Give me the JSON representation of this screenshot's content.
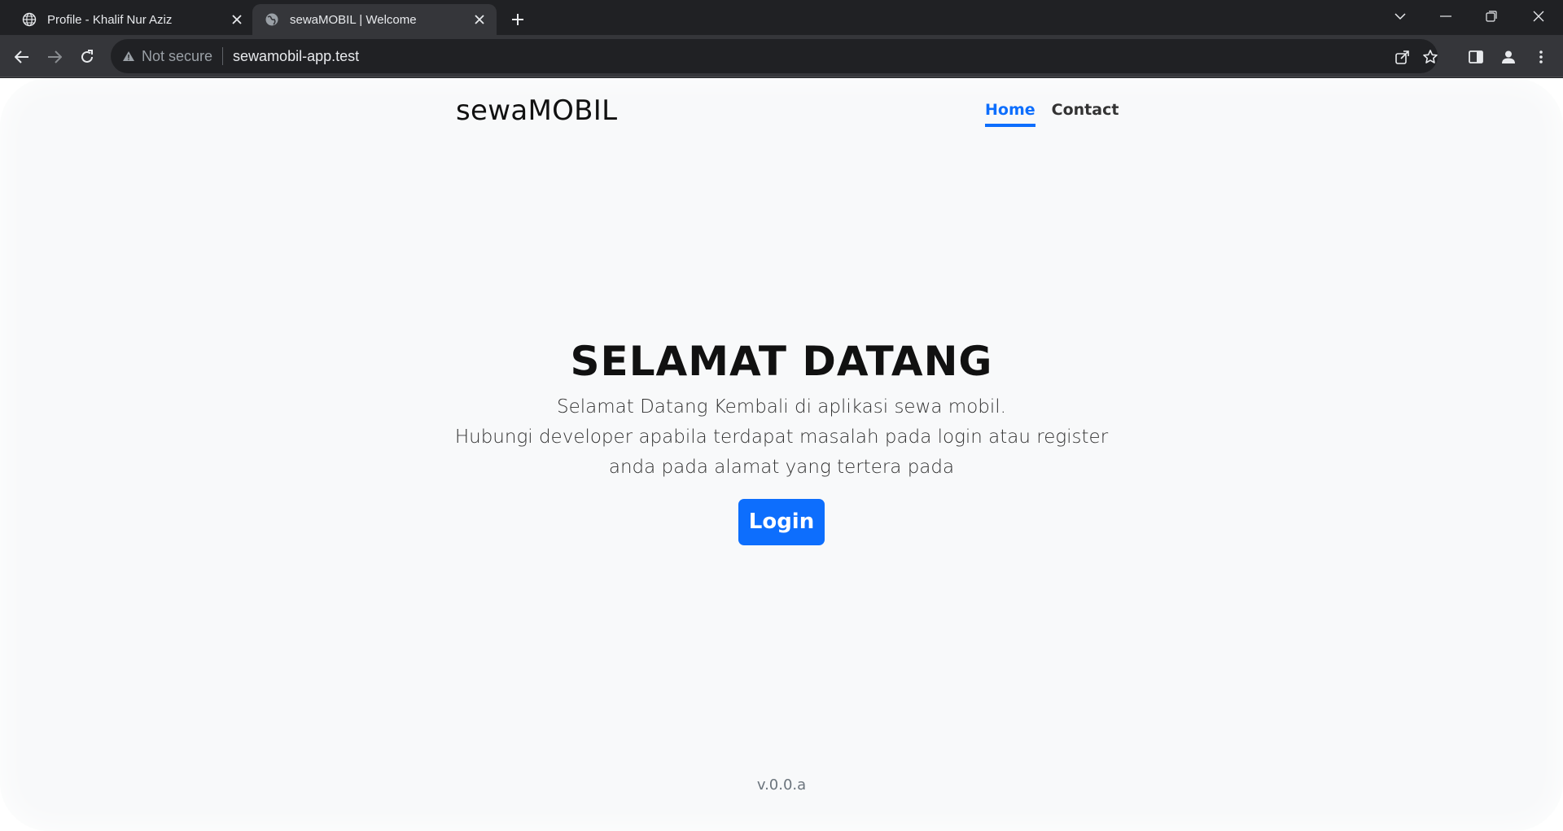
{
  "browser": {
    "tabs": [
      {
        "title": "Profile - Khalif Nur Aziz",
        "favicon": "globe-icon",
        "active": false
      },
      {
        "title": "sewaMOBIL | Welcome",
        "favicon": "globe-icon",
        "active": true
      }
    ],
    "address_bar": {
      "security_label": "Not secure",
      "url": "sewamobil-app.test"
    },
    "colors": {
      "tab_strip": "#202124",
      "toolbar": "#35363a",
      "text": "#e8eaed"
    }
  },
  "site": {
    "brand": "sewaMOBIL",
    "nav": [
      {
        "label": "Home",
        "active": true
      },
      {
        "label": "Contact",
        "active": false
      }
    ],
    "hero": {
      "title": "SELAMAT DATANG",
      "line1": "Selamat Datang Kembali di aplikasi sewa mobil.",
      "line2": "Hubungi developer apabila terdapat masalah pada login atau register",
      "line3": "anda pada alamat yang tertera pada",
      "button_label": "Login"
    },
    "footer_version": "v.0.0.a",
    "colors": {
      "accent": "#0d6efd",
      "background": "#f8f9fa"
    }
  }
}
